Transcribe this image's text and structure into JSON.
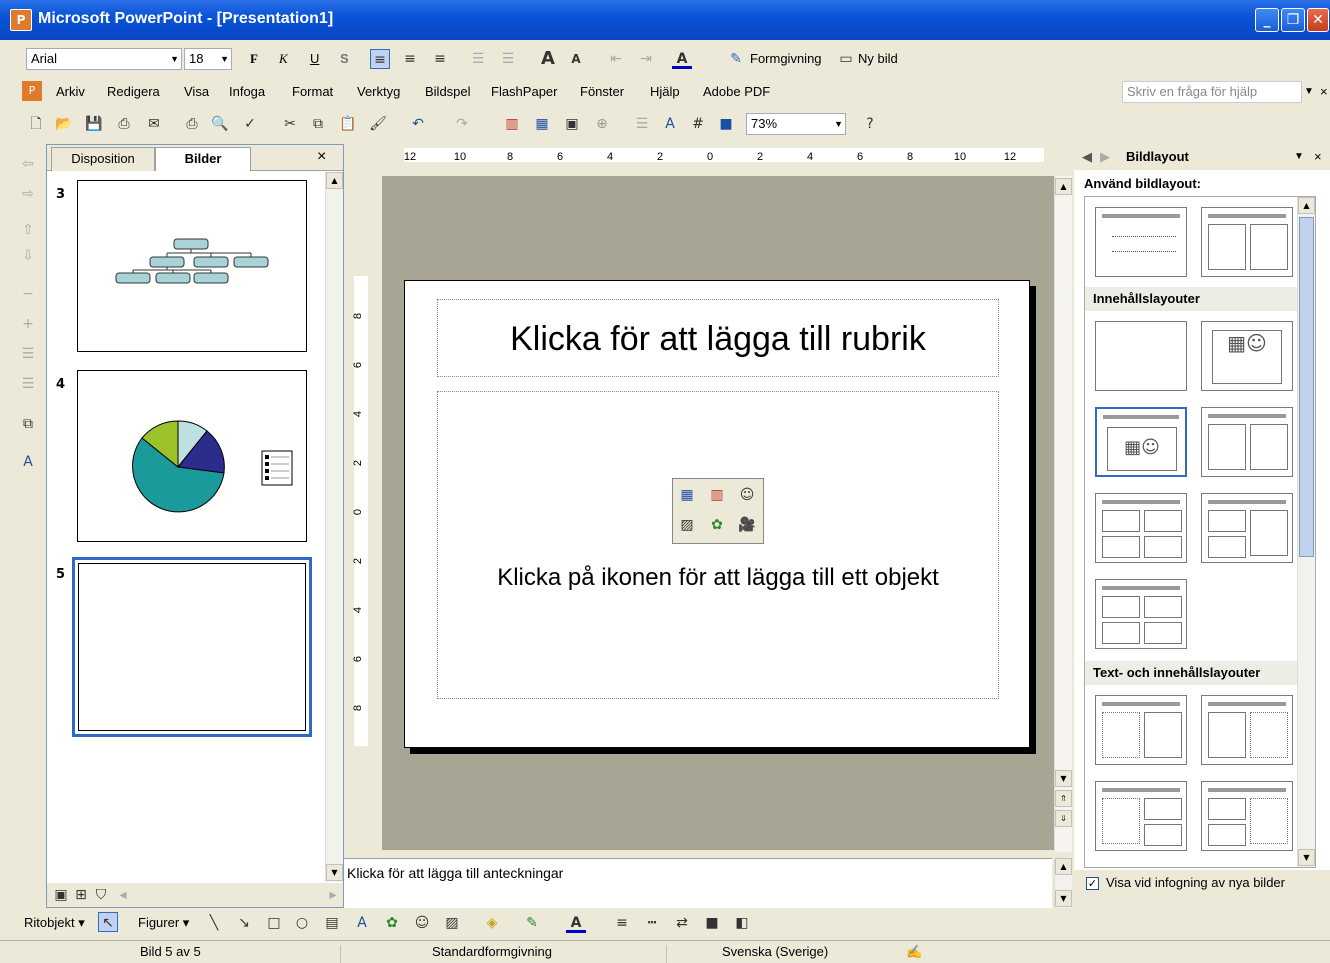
{
  "window": {
    "title": "Microsoft PowerPoint - [Presentation1]"
  },
  "formatting": {
    "font": "Arial",
    "size": "18",
    "bold": "F",
    "italic": "K",
    "underline": "U",
    "shadow": "S",
    "design_label": "Formgivning",
    "new_slide_label": "Ny bild"
  },
  "menu": {
    "items": [
      "Arkiv",
      "Redigera",
      "Visa",
      "Infoga",
      "Format",
      "Verktyg",
      "Bildspel",
      "FlashPaper",
      "Fönster",
      "Hjälp",
      "Adobe PDF"
    ],
    "help_placeholder": "Skriv en fråga för hjälp"
  },
  "standard": {
    "zoom": "73%"
  },
  "thumbpane": {
    "tab_outline": "Disposition",
    "tab_slides": "Bilder",
    "close": "×",
    "slides": [
      {
        "num": "3"
      },
      {
        "num": "4"
      },
      {
        "num": "5"
      }
    ]
  },
  "ruler": {
    "h_labels": [
      "12",
      "10",
      "8",
      "6",
      "4",
      "2",
      "0",
      "2",
      "4",
      "6",
      "8",
      "10",
      "12"
    ],
    "v_labels": [
      "8",
      "6",
      "4",
      "2",
      "0",
      "2",
      "4",
      "6",
      "8"
    ]
  },
  "slide": {
    "title_placeholder": "Klicka för att lägga till rubrik",
    "content_placeholder": "Klicka på ikonen för att lägga till ett objekt"
  },
  "notes": {
    "placeholder": "Klicka för att lägga till anteckningar"
  },
  "taskpane": {
    "title": "Bildlayout",
    "apply_label": "Använd bildlayout:",
    "section_content": "Innehållslayouter",
    "section_text_content": "Text- och innehållslayouter",
    "show_on_insert": "Visa vid infogning av nya bilder"
  },
  "drawing": {
    "draw_label": "Ritobjekt",
    "shapes_label": "Figurer"
  },
  "status": {
    "slide_info": "Bild 5 av 5",
    "design": "Standardformgivning",
    "language": "Svenska (Sverige)"
  },
  "chart_colors": {
    "teal": "#1a9a9a",
    "navy": "#2c2c8c",
    "green": "#9cc22a",
    "light": "#bde0e0"
  }
}
